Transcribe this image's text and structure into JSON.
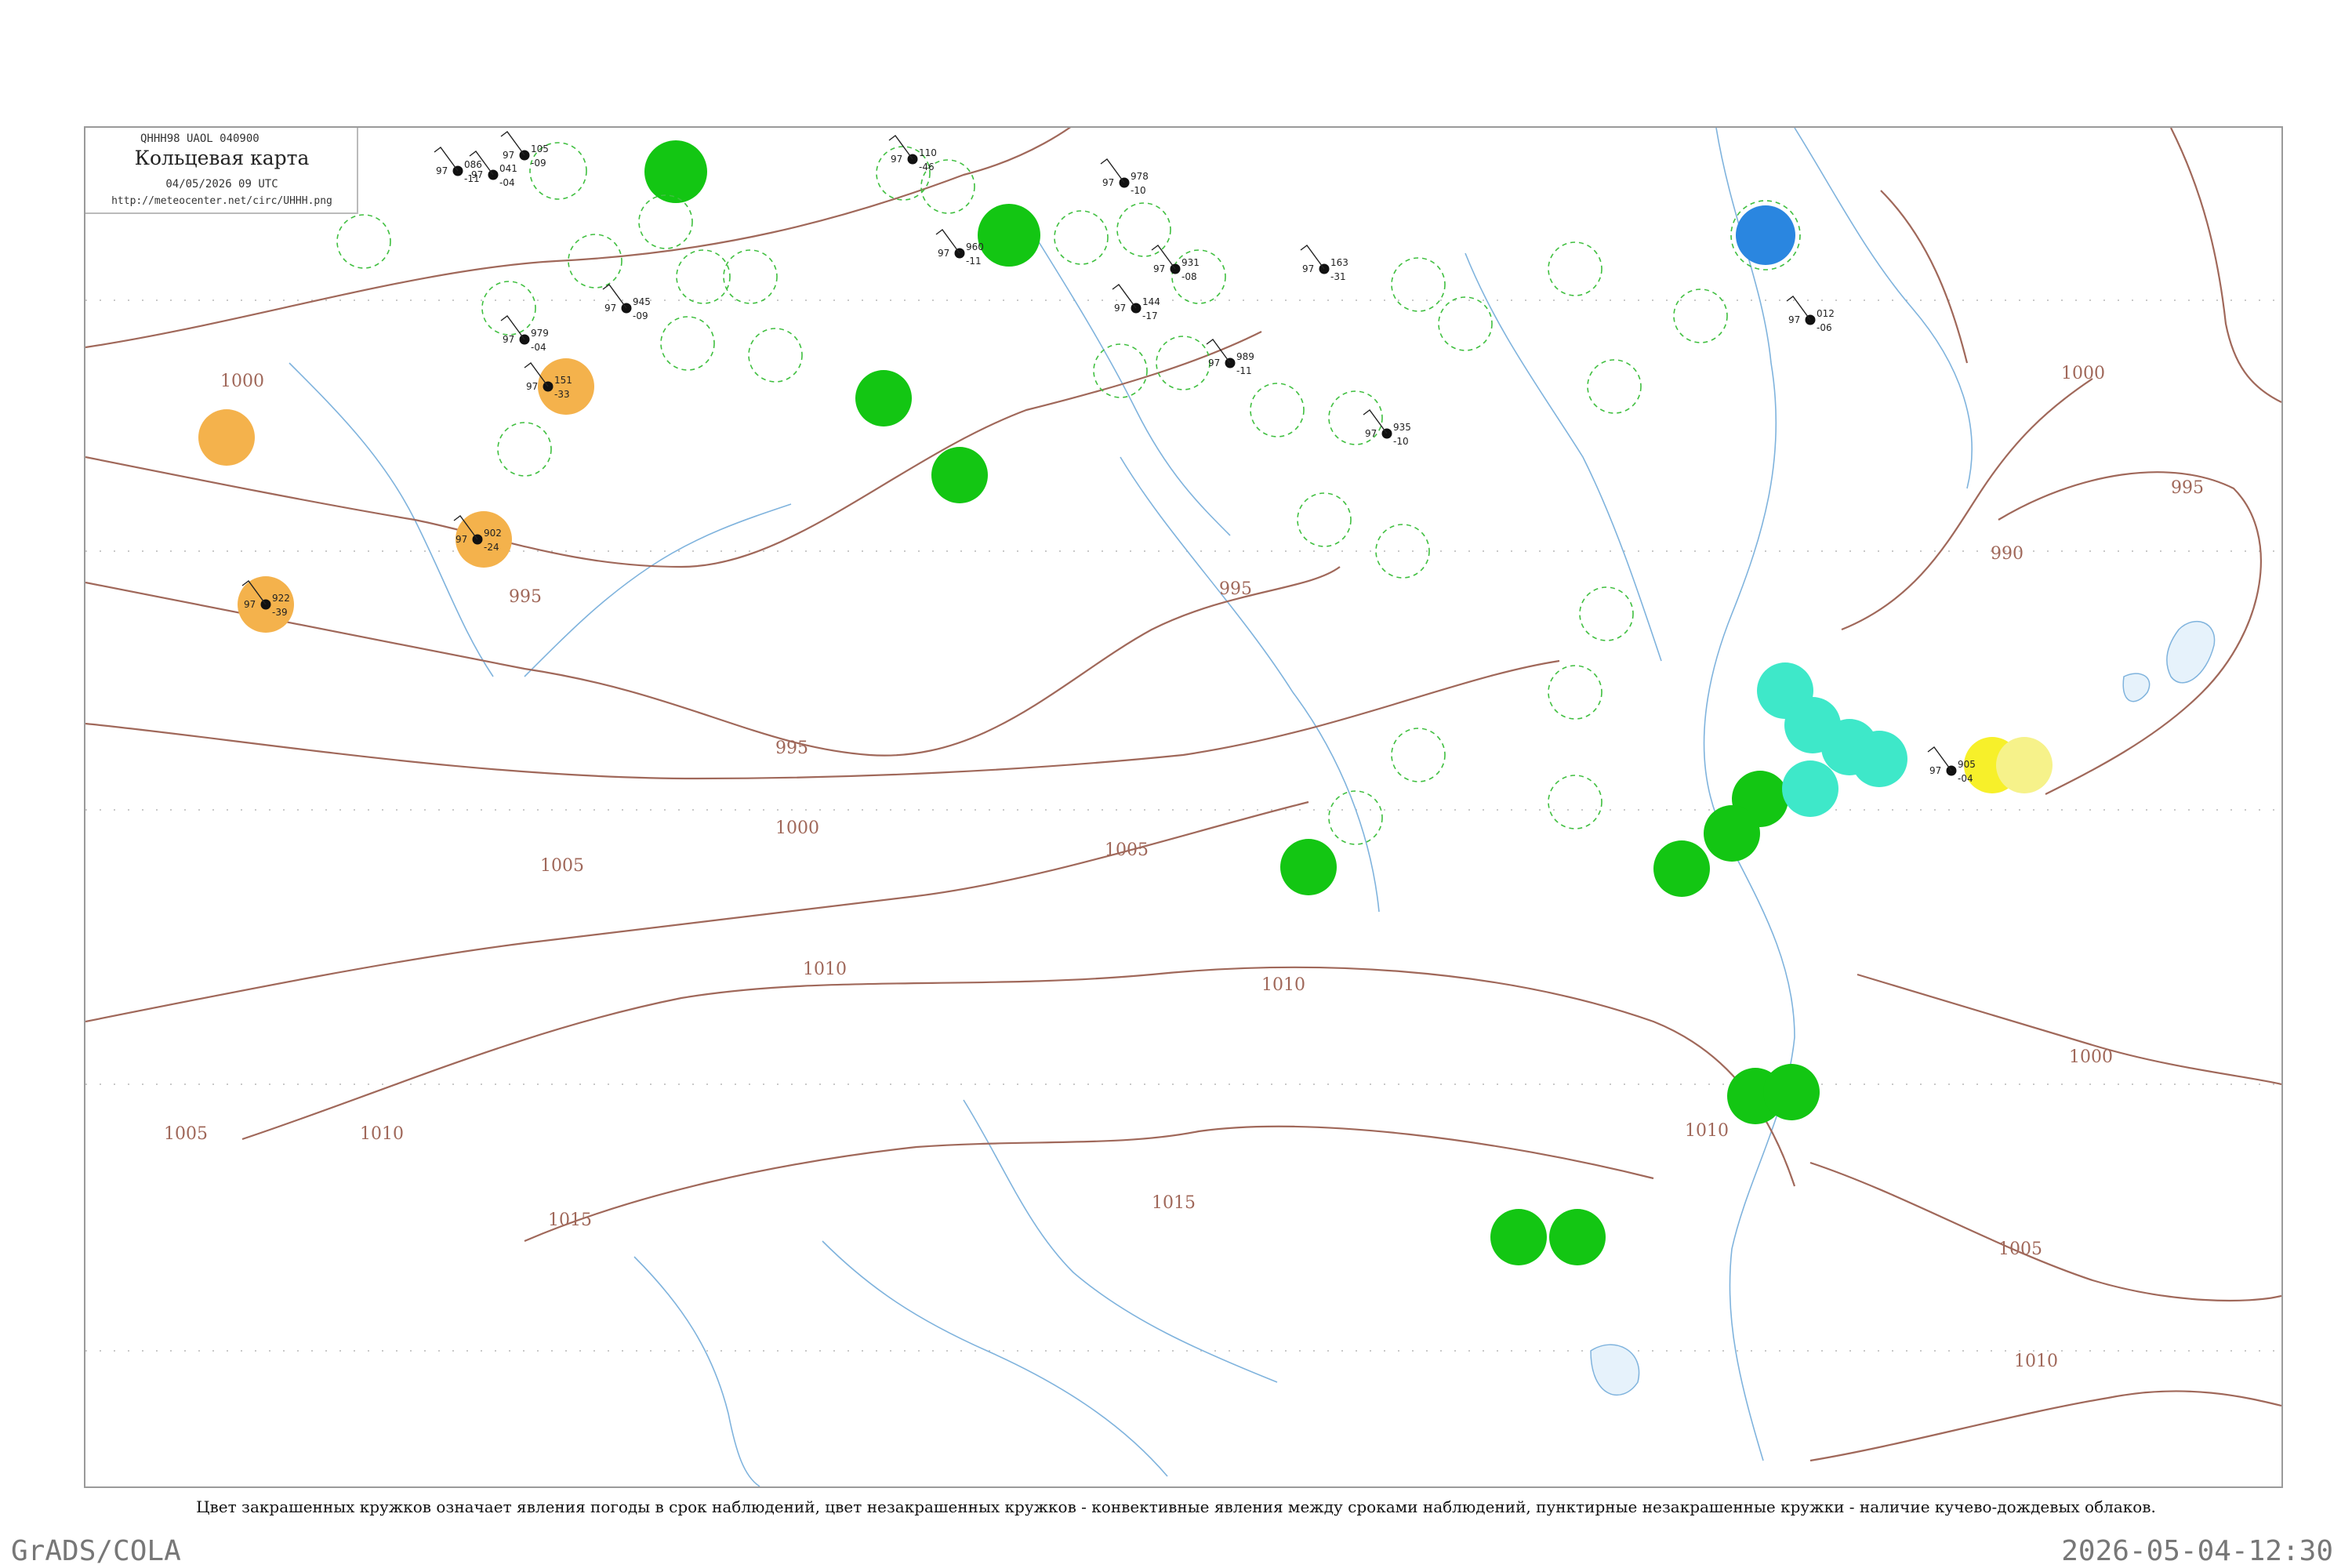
{
  "header": {
    "code": "QHHH98  UAOL  040900",
    "title": "Кольцевая карта",
    "date": "04/05/2026 09 UTC",
    "url": "http://meteocenter.net/circ/UHHH.png"
  },
  "caption": "Цвет закрашенных кружков означает явления погоды в срок наблюдений, цвет незакрашенных кружков - конвективные явления между сроками наблюдений, пунктирные незакрашенные кружки - наличие кучево-дождевых облаков.",
  "footer": {
    "left": "GrADS/COLA",
    "right": "2026-05-04-12:30"
  },
  "colors": {
    "isobar": "#a0685a",
    "river": "#7fb3dd",
    "dashed_ring": "#3fbf3f",
    "green_fill": "#13c613",
    "orange_fill": "#f4b24c",
    "cyan_fill": "#3ee8c9",
    "blue_fill": "#2a86e0",
    "yellow_fill": "#f7f02a",
    "pale_yellow_fill": "#f6f28a"
  },
  "isobar_labels": [
    "1000",
    "995",
    "995",
    "995",
    "1000",
    "1005",
    "1005",
    "1010",
    "1010",
    "1015",
    "1015",
    "1010",
    "1005",
    "1000",
    "1010",
    "1000",
    "995",
    "990",
    "1005",
    "1010"
  ],
  "station_samples": [
    {
      "p": "105",
      "t": "97",
      "d": "-09"
    },
    {
      "p": "041",
      "t": "97",
      "d": "-04"
    },
    {
      "p": "086",
      "t": "97",
      "d": "-11"
    },
    {
      "p": "945",
      "t": "97",
      "d": "-09"
    },
    {
      "p": "110",
      "t": "97",
      "d": "-46"
    },
    {
      "p": "960",
      "t": "97",
      "d": "-11"
    },
    {
      "p": "978",
      "t": "97",
      "d": "-10"
    },
    {
      "p": "931",
      "t": "97",
      "d": "-08"
    },
    {
      "p": "151",
      "t": "97",
      "d": "-33"
    },
    {
      "p": "979",
      "t": "97",
      "d": "-04"
    },
    {
      "p": "902",
      "t": "97",
      "d": "-24"
    },
    {
      "p": "922",
      "t": "97",
      "d": "-39"
    },
    {
      "p": "144",
      "t": "97",
      "d": "-17"
    },
    {
      "p": "989",
      "t": "97",
      "d": "-11"
    },
    {
      "p": "163",
      "t": "97",
      "d": "-31"
    },
    {
      "p": "935",
      "t": "97",
      "d": "-10"
    },
    {
      "p": "905",
      "t": "97",
      "d": "-04"
    },
    {
      "p": "012",
      "t": "97",
      "d": "-06"
    }
  ]
}
